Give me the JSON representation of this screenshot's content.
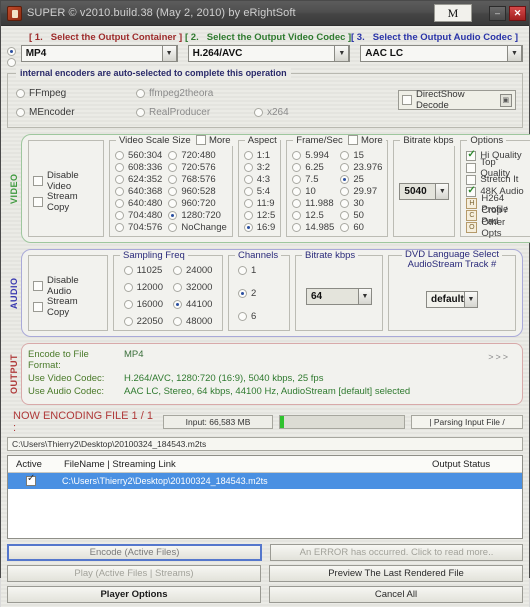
{
  "window": {
    "title": "SUPER © v2010.build.38 (May 2, 2010) by eRightSoft",
    "m_button": "M",
    "minimize": "–",
    "close": "✕",
    "accent_red": "#9d2b2b",
    "accent_green": "#2f7a2f",
    "accent_blue": "#2a34a8",
    "selection_blue": "#4a90e2",
    "progress_green": "#2fc22f"
  },
  "selectors": {
    "container": {
      "num": "[ 1.",
      "label": "Select the Output Container ]",
      "value": "MP4"
    },
    "video_codec": {
      "num": "[ 2.",
      "label": "Select the Output Video Codec ]",
      "value": "H.264/AVC"
    },
    "audio_codec": {
      "num": "[ 3.",
      "label": "Select the Output Audio Codec ]",
      "value": "AAC LC"
    }
  },
  "encoders": {
    "legend": "internal encoders are auto-selected to complete this operation",
    "items": [
      {
        "label": "FFmpeg",
        "selected": true
      },
      {
        "label": "ffmpeg2theora",
        "selected": false
      },
      {
        "label": "MEncoder",
        "selected": false
      },
      {
        "label": "RealProducer",
        "selected": false
      },
      {
        "label": "x264",
        "selected": true
      }
    ],
    "directshow": {
      "label": "DirectShow Decode",
      "checked": false,
      "btn": "▣"
    }
  },
  "video": {
    "section_label": "VIDEO",
    "disable": {
      "label": "Disable Video",
      "checked": false
    },
    "stream_copy": {
      "label": "Stream Copy",
      "checked": false
    },
    "scale": {
      "legend": "Video Scale Size",
      "more_label": "More",
      "more_checked": false,
      "col1": [
        "560:304",
        "608:336",
        "624:352",
        "640:368",
        "640:480",
        "704:480",
        "704:576"
      ],
      "col2": [
        "720:480",
        "720:576",
        "768:576",
        "960:528",
        "960:720",
        "1280:720",
        "NoChange"
      ],
      "selected": "1280:720"
    },
    "aspect": {
      "legend": "Aspect",
      "values": [
        "1:1",
        "3:2",
        "4:3",
        "5:4",
        "11:9",
        "12:5",
        "16:9"
      ],
      "selected": "16:9"
    },
    "framerate": {
      "legend": "Frame/Sec",
      "more_label": "More",
      "more_checked": false,
      "col1": [
        "5.994",
        "6.25",
        "7.5",
        "10",
        "11.988",
        "12.5",
        "14.985"
      ],
      "col2": [
        "15",
        "23.976",
        "25",
        "29.97",
        "30",
        "50",
        "60"
      ],
      "selected": "25"
    },
    "bitrate": {
      "legend": "Bitrate  kbps",
      "value": "5040"
    },
    "options": {
      "legend": "Options",
      "items": [
        {
          "label": "Hi Quality",
          "type": "check",
          "checked": true
        },
        {
          "label": "Top Quality",
          "type": "check",
          "checked": false
        },
        {
          "label": "Stretch It",
          "type": "check",
          "checked": false
        },
        {
          "label": "48K Audio",
          "type": "check",
          "checked": true
        },
        {
          "label": "H264 Profile",
          "type": "button",
          "glyph": "H"
        },
        {
          "label": "Crop / Pad",
          "type": "button",
          "glyph": "C"
        },
        {
          "label": "Other Opts",
          "type": "button",
          "glyph": "O"
        }
      ]
    }
  },
  "audio": {
    "section_label": "AUDIO",
    "disable": {
      "label": "Disable Audio",
      "checked": false
    },
    "stream_copy": {
      "label": "Stream Copy",
      "checked": false
    },
    "sampling": {
      "legend": "Sampling Freq",
      "col1": [
        "11025",
        "12000",
        "16000",
        "22050"
      ],
      "col2": [
        "24000",
        "32000",
        "44100",
        "48000"
      ],
      "selected": "44100"
    },
    "channels": {
      "legend": "Channels",
      "values": [
        "1",
        "2",
        "6"
      ],
      "selected": "2"
    },
    "bitrate": {
      "legend": "Bitrate  kbps",
      "value": "64"
    },
    "dvd_lang": {
      "legend_line1": "DVD Language Select",
      "legend_line2": "AudioStream  Track #",
      "value": "default"
    }
  },
  "output": {
    "section_label": "OUTPUT",
    "chevron": ">>>",
    "lines": [
      {
        "key": "Encode to File Format:",
        "value": "MP4"
      },
      {
        "key": "Use Video Codec:",
        "value": "H.264/AVC,  1280:720 (16:9),  5040 kbps,  25 fps"
      },
      {
        "key": "Use Audio Codec:",
        "value": "AAC LC,  Stereo,  64 kbps,  44100 Hz,  AudioStream [default] selected"
      }
    ]
  },
  "encoding": {
    "status": "NOW ENCODING FILE 1 / 1 :",
    "input_size": "Input: 66,583 MB",
    "progress_percent": 3,
    "parsing": "|  Parsing Input File   /",
    "path": "C:\\Users\\Thierry2\\Desktop\\20100324_184543.m2ts"
  },
  "file_table": {
    "headers": {
      "active": "Active",
      "filename": "FileName  |  Streaming Link",
      "status": "Output Status"
    },
    "rows": [
      {
        "active": true,
        "filename": "C:\\Users\\Thierry2\\Desktop\\20100324_184543.m2ts",
        "status": ""
      }
    ]
  },
  "buttons": {
    "encode": "Encode (Active Files)",
    "error": "An ERROR has occurred. Click to read more..",
    "play": "Play (Active Files | Streams)",
    "preview": "Preview The Last Rendered File",
    "player_options": "Player Options",
    "cancel_all": "Cancel All"
  }
}
